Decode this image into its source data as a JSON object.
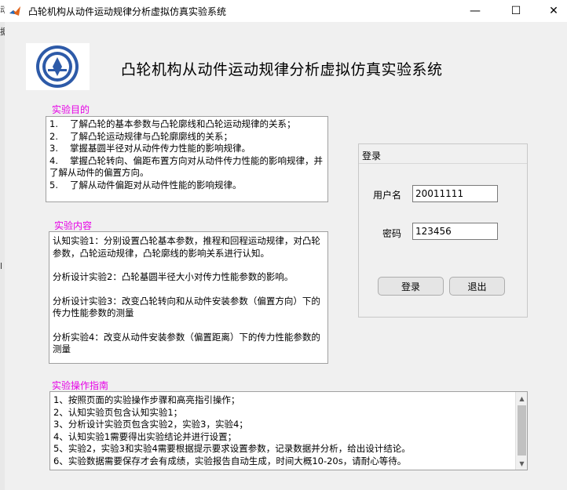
{
  "window": {
    "title": "凸轮机构从动件运动规律分析虚拟仿真实验系统",
    "minimize": "—",
    "maximize": "☐",
    "close": "✕"
  },
  "left_edge": {
    "glyphs": [
      "动",
      "据",
      "l"
    ]
  },
  "header": {
    "title": "凸轮机构从动件运动规律分析虚拟仿真实验系统"
  },
  "purpose": {
    "label": "实验目的",
    "items": [
      {
        "num": "1.",
        "text": "了解凸轮的基本参数与凸轮廓线和凸轮运动规律的关系；"
      },
      {
        "num": "2.",
        "text": "了解凸轮运动规律与凸轮廓廓线的关系；"
      },
      {
        "num": "3.",
        "text": "掌握基圆半径对从动件传力性能的影响规律。"
      },
      {
        "num": "4.",
        "text": "掌握凸轮转向、偏距布置方向对从动件传力性能的影响规律，并了解从动件的偏置方向。"
      },
      {
        "num": "5.",
        "text": "了解从动件偏距对从动件性能的影响规律。"
      }
    ]
  },
  "content": {
    "label": "实验内容",
    "paragraphs": [
      "认知实验1：分别设置凸轮基本参数，推程和回程运动规律，对凸轮参数，凸轮运动规律，凸轮廓线的影响关系进行认知。",
      "分析设计实验2：凸轮基圆半径大小对传力性能参数的影响。",
      "分析设计实验3：改变凸轮转向和从动件安装参数（偏置方向）下的传力性能参数的测量",
      "分析实验4：改变从动件安装参数（偏置距离）下的传力性能参数的测量"
    ]
  },
  "guide": {
    "label": "实验操作指南",
    "lines": [
      "1、按照页面的实验操作步骤和高亮指引操作；",
      "2、认知实验页包含认知实验1；",
      "3、分析设计实验页包含实验2，实验3，实验4；",
      "4、认知实验1需要得出实验结论并进行设置；",
      "5、实验2，实验3和实验4需要根据提示要求设置参数，记录数据并分析，给出设计结论。",
      "6、实验数据需要保存才会有成绩，实验报告自动生成，时间大概10-20s，请耐心等待。"
    ]
  },
  "login": {
    "title": "登录",
    "username_label": "用户名",
    "username_value": "20011111",
    "password_label": "密码",
    "password_value": "123456",
    "login_button": "登录",
    "exit_button": "退出"
  },
  "scrollbar": {
    "up_icon": "▲",
    "down_icon": "▼"
  }
}
